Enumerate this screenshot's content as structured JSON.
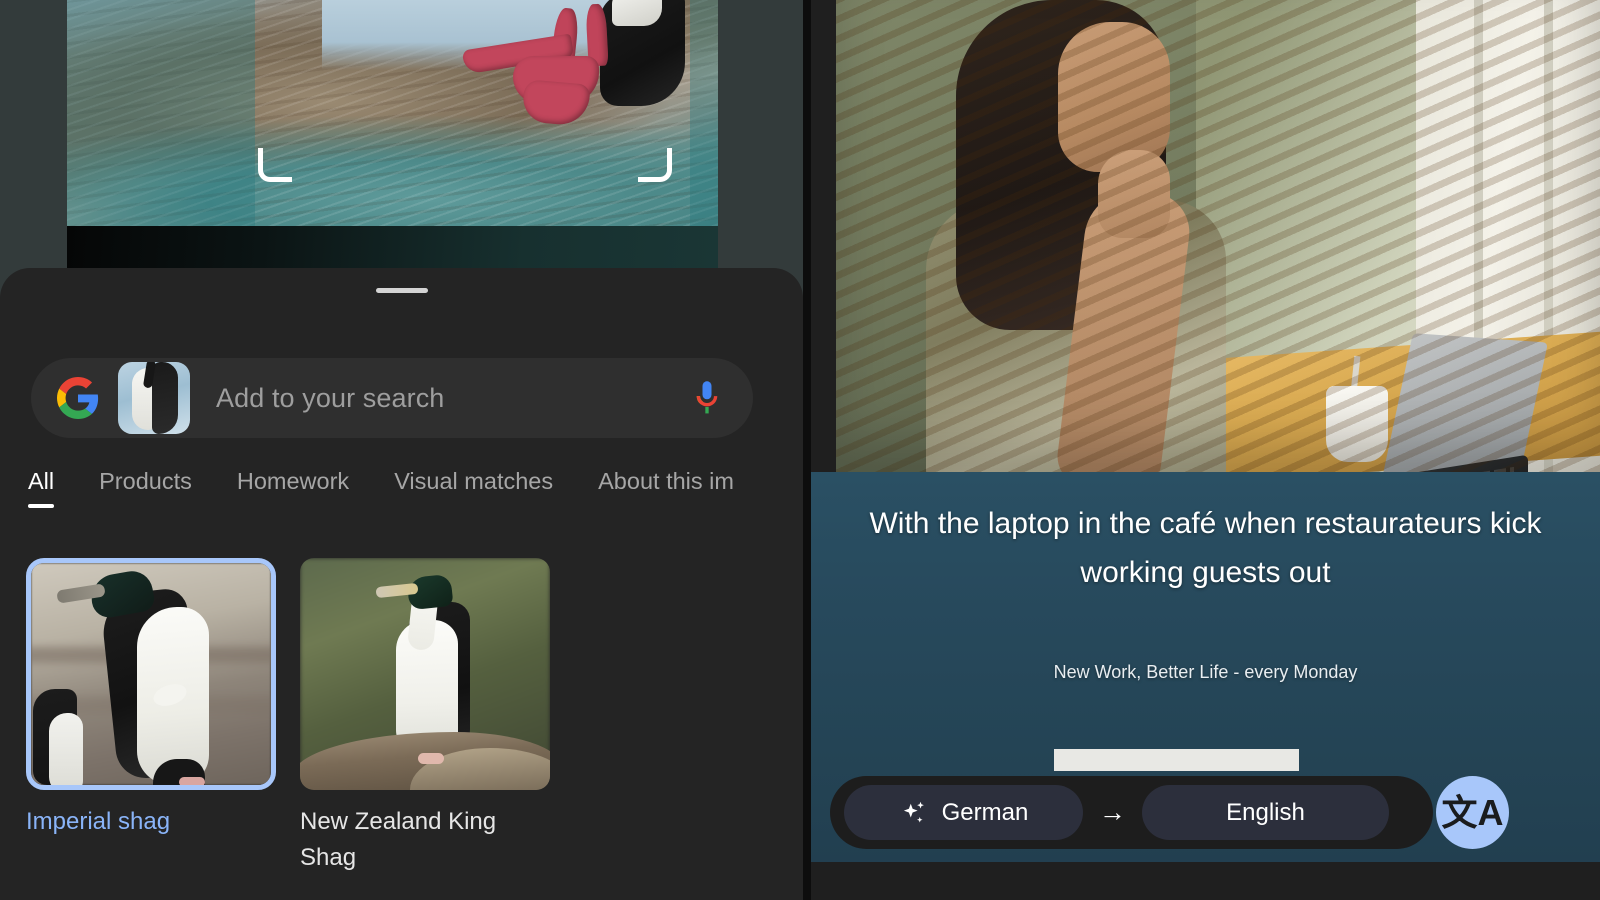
{
  "lens": {
    "crop_overlay": {
      "label": "lens-crop-selection"
    },
    "sheet": {
      "handle_label": "drag-handle"
    },
    "search": {
      "placeholder": "Add to your search",
      "value": "",
      "google_logo": "google-g-icon",
      "thumbnail": "lens-image-thumbnail",
      "mic": "microphone-icon"
    },
    "tabs": [
      {
        "label": "All",
        "active": true
      },
      {
        "label": "Products",
        "active": false
      },
      {
        "label": "Homework",
        "active": false
      },
      {
        "label": "Visual matches",
        "active": false
      },
      {
        "label": "About this im",
        "active": false
      }
    ],
    "results": [
      {
        "label": "Imperial shag",
        "selected": true
      },
      {
        "label": "New Zealand King Shag",
        "selected": false
      }
    ]
  },
  "translate": {
    "headline": "With the laptop in the café when restaurateurs kick working guests out",
    "subline": "New Work, Better Life - every Monday",
    "source_language": "German",
    "target_language": "English",
    "arrow": "→",
    "sparkle_icon": "sparkle-icon",
    "fab_icon": "文A",
    "fab_label": "translate-button"
  },
  "colors": {
    "accent_blue": "#8ab4f8",
    "selection_border": "#a8c7fa",
    "sheet_background": "#242424",
    "search_background": "#2f2f2f",
    "translate_panel": "#27495c",
    "fab_background": "#a8c7fa"
  }
}
